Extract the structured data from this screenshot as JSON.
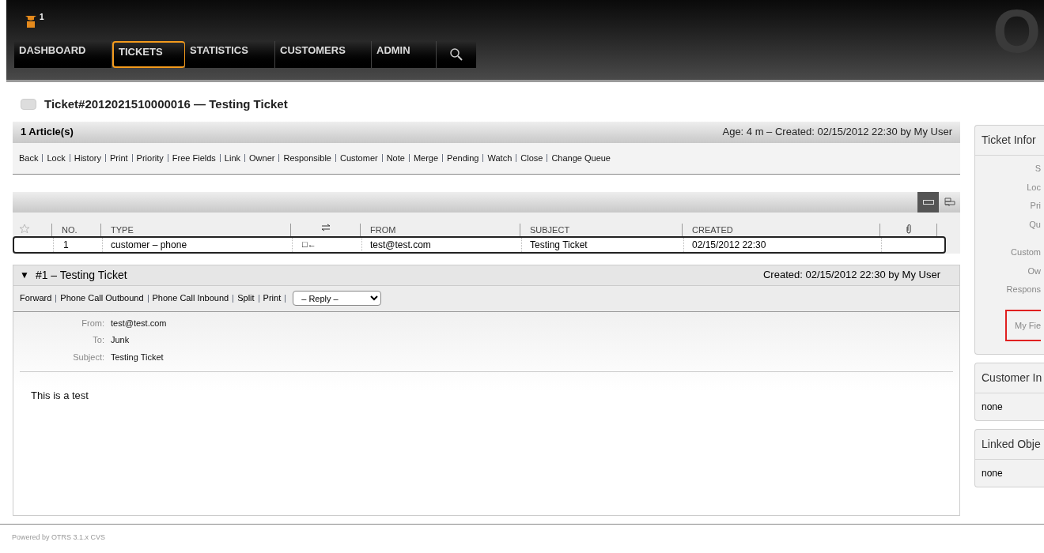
{
  "header": {
    "notification_count": "1",
    "logo_text": "O",
    "nav": [
      {
        "label": "DASHBOARD",
        "selected": false
      },
      {
        "label": "TICKETS",
        "selected": true
      },
      {
        "label": "STATISTICS",
        "selected": false
      },
      {
        "label": "CUSTOMERS",
        "selected": false
      },
      {
        "label": "ADMIN",
        "selected": false
      }
    ]
  },
  "ticket_title": "Ticket#2012021510000016 — Testing Ticket",
  "article_summary": {
    "count": "1 Article(s)",
    "meta": "Age: 4 m – Created: 02/15/2012 22:30 by My User"
  },
  "actions": [
    "Back",
    "Lock",
    "History",
    "Print",
    "Priority",
    "Free Fields",
    "Link",
    "Owner",
    "Responsible",
    "Customer",
    "Note",
    "Merge",
    "Pending",
    "Watch",
    "Close",
    "Change Queue"
  ],
  "view_toggles": [
    {
      "selected": true
    },
    {
      "selected": false
    }
  ],
  "article_table": {
    "columns": [
      "NO.",
      "TYPE",
      "FROM",
      "SUBJECT",
      "CREATED"
    ],
    "rows": [
      {
        "selected": true,
        "no": "1",
        "type": "customer – phone",
        "direction": "□←",
        "from": "test@test.com",
        "subject": "Testing Ticket",
        "created": "02/15/2012 22:30"
      }
    ]
  },
  "article": {
    "expanded": true,
    "toggle": "▼",
    "title": "#1 – Testing Ticket",
    "created": "Created: 02/15/2012 22:30 by My User",
    "actions": [
      "Forward",
      "Phone Call Outbound",
      "Phone Call Inbound",
      "Split",
      "Print"
    ],
    "reply_select": "– Reply –",
    "fields": [
      {
        "label": "From:",
        "value": "test@test.com"
      },
      {
        "label": "To:",
        "value": "Junk"
      },
      {
        "label": "Subject:",
        "value": "Testing Ticket"
      }
    ],
    "body": "This is a test"
  },
  "sidebar": {
    "ticket_info": {
      "title": "Ticket Infor",
      "labels": [
        {
          "text": "S",
          "highlighted": false
        },
        {
          "text": "Loc",
          "highlighted": false
        },
        {
          "text": "Pri",
          "highlighted": false
        },
        {
          "text": "Qu",
          "highlighted": false
        },
        {
          "text": "Custom",
          "highlighted": false
        },
        {
          "text": "Ow",
          "highlighted": false
        },
        {
          "text": "Respons",
          "highlighted": false
        },
        {
          "text": "My Fie",
          "highlighted": true
        }
      ]
    },
    "customer_info": {
      "title": "Customer In",
      "value": "none"
    },
    "linked_objects": {
      "title": "Linked Obje",
      "value": "none"
    }
  },
  "footer": "Powered by OTRS 3.1.x CVS"
}
